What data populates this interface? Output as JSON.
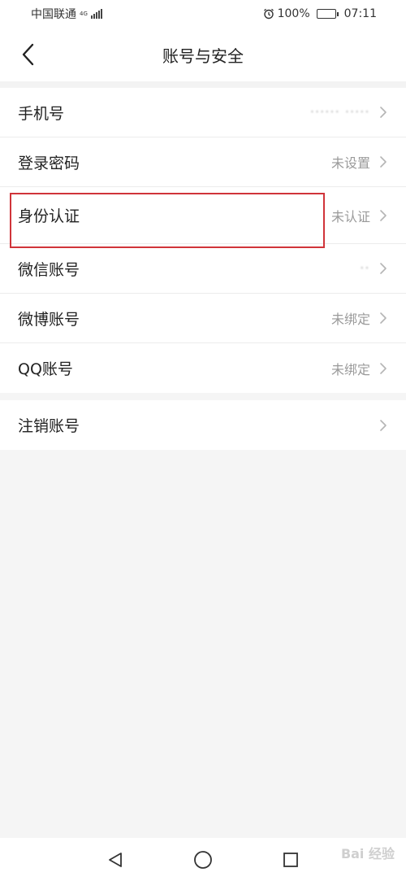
{
  "status_bar": {
    "carrier": "中国联通",
    "network_tag": "4G",
    "battery_pct": "100%",
    "time": "07:11"
  },
  "header": {
    "title": "账号与安全"
  },
  "section_1": {
    "rows": [
      {
        "label": "手机号",
        "value": "······ ·····"
      },
      {
        "label": "登录密码",
        "value": "未设置"
      },
      {
        "label": "身份认证",
        "value": "未认证"
      },
      {
        "label": "微信账号",
        "value": "··"
      },
      {
        "label": "微博账号",
        "value": "未绑定"
      },
      {
        "label": "QQ账号",
        "value": "未绑定"
      }
    ]
  },
  "section_2": {
    "rows": [
      {
        "label": "注销账号"
      }
    ]
  },
  "watermark": "Bai 经验"
}
